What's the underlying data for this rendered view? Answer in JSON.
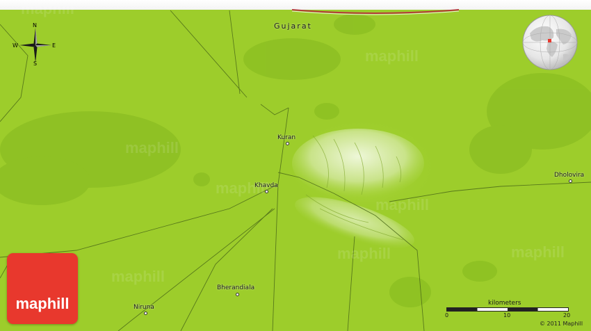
{
  "map": {
    "region_label": "Gujarat",
    "places": {
      "kuran": "Kuran",
      "khavda": "Khavda",
      "dholavira": "Dholovira",
      "bherandiala": "Bherandiala",
      "niruna": "Niruna"
    },
    "watermark_text": "maphill",
    "colors": {
      "land": "#9cce2a",
      "land_light": "#b5dc45",
      "hills": "#d9ecb0",
      "roads": "#4b6a18",
      "border": "#b33a3a",
      "logo_bg": "#e8382d"
    }
  },
  "compass": {
    "n": "N",
    "s": "S",
    "e": "E",
    "w": "W"
  },
  "logo": {
    "text": "maphill"
  },
  "scale": {
    "title": "kilometers",
    "ticks": [
      "0",
      "10",
      "20"
    ]
  },
  "copyright": "© 2011 Maphill"
}
